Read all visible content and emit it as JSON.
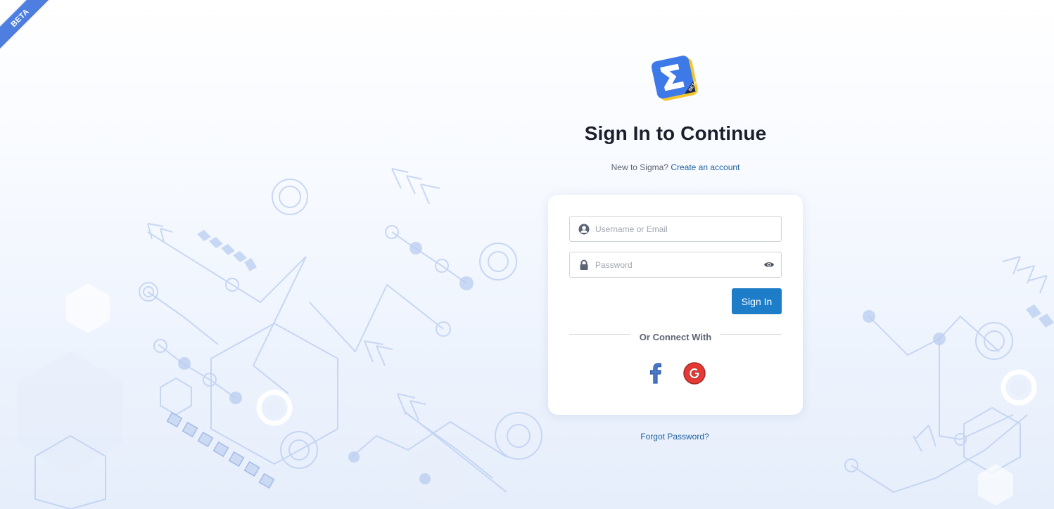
{
  "ribbon": {
    "label": "BETA"
  },
  "logo": {
    "badge_text": "BETA"
  },
  "header": {
    "title": "Sign In to Continue",
    "signup_prompt": "New to Sigma?",
    "signup_link": "Create an account"
  },
  "form": {
    "username_placeholder": "Username or Email",
    "password_placeholder": "Password",
    "signin_label": "Sign In",
    "divider_label": "Or Connect With"
  },
  "social": {
    "facebook_icon": "facebook-icon",
    "google_icon": "google-icon"
  },
  "footer": {
    "forgot_password": "Forgot Password?"
  },
  "colors": {
    "primary_button": "#1e7dc8",
    "link": "#1f5f9e",
    "ribbon": "#4e7fe0",
    "logo_blue": "#3d7ae8",
    "logo_yellow": "#f5c52a"
  }
}
